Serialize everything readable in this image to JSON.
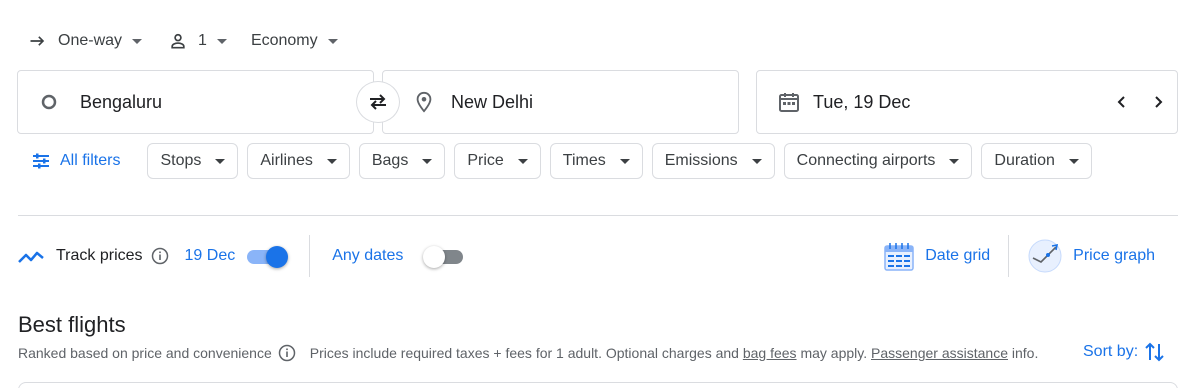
{
  "trip": {
    "type_label": "One-way",
    "passengers": "1",
    "cabin_class": "Economy"
  },
  "search": {
    "origin": "Bengaluru",
    "destination": "New Delhi",
    "departure_date": "Tue, 19 Dec"
  },
  "filters": {
    "all_filters_label": "All filters",
    "chips": [
      "Stops",
      "Airlines",
      "Bags",
      "Price",
      "Times",
      "Emissions",
      "Connecting airports",
      "Duration"
    ]
  },
  "tracking": {
    "label": "Track prices",
    "date": "19 Dec",
    "date_toggle_on": true,
    "any_dates_label": "Any dates",
    "any_dates_toggle_on": false
  },
  "tools": {
    "date_grid_label": "Date grid",
    "price_graph_label": "Price graph"
  },
  "results": {
    "title": "Best flights",
    "subtitle": "Ranked based on price and convenience",
    "price_note_pre": "Prices include required taxes + fees for 1 adult. Optional charges and",
    "bag_fees_link": "bag fees",
    "price_note_mid": "may apply.",
    "passenger_assistance_link": "Passenger assistance",
    "price_note_post": "info.",
    "sort_label": "Sort by:"
  },
  "colors": {
    "accent": "#1a73e8",
    "toggle_track_on": "#8ab4f8",
    "border": "#dadce0",
    "text": "#202124",
    "secondary_text": "#5f6368"
  }
}
